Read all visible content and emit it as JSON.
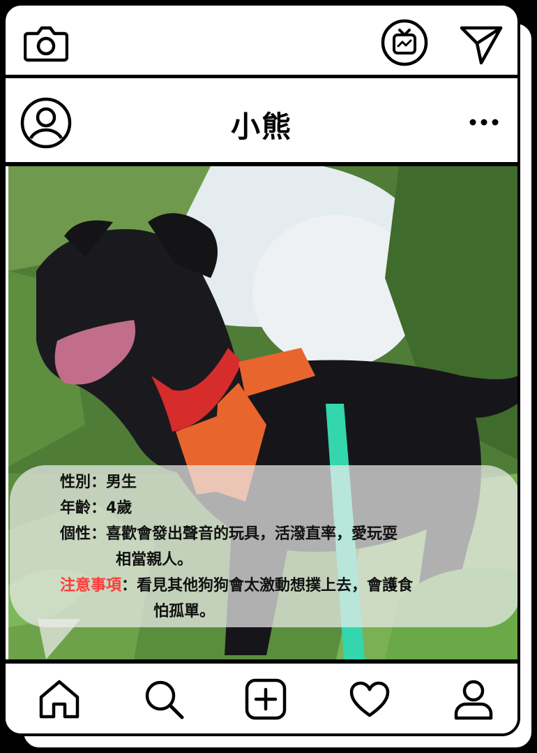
{
  "profile": {
    "name": "小熊"
  },
  "info": {
    "gender_label": "性別：",
    "gender_value": "男生",
    "age_label": "年齡：",
    "age_value": "4歲",
    "personality_label": "個性：",
    "personality_line1": "喜歡會發出聲音的玩具，活潑直率，愛玩耍",
    "personality_line2": "相當親人。",
    "notes_label": "注意事項",
    "notes_line1": "：看見其他狗狗會太激動想撲上去，會護食",
    "notes_line2": "怕孤單。"
  },
  "colors": {
    "warn": "#ff3b3b",
    "border": "#000000"
  },
  "icons": {
    "top_left": "camera-icon",
    "top_right": [
      "igtv-icon",
      "send-icon"
    ],
    "profile": [
      "avatar-icon",
      "more-icon"
    ],
    "bottom_nav": [
      "home-icon",
      "search-icon",
      "add-post-icon",
      "heart-icon",
      "profile-icon"
    ]
  }
}
